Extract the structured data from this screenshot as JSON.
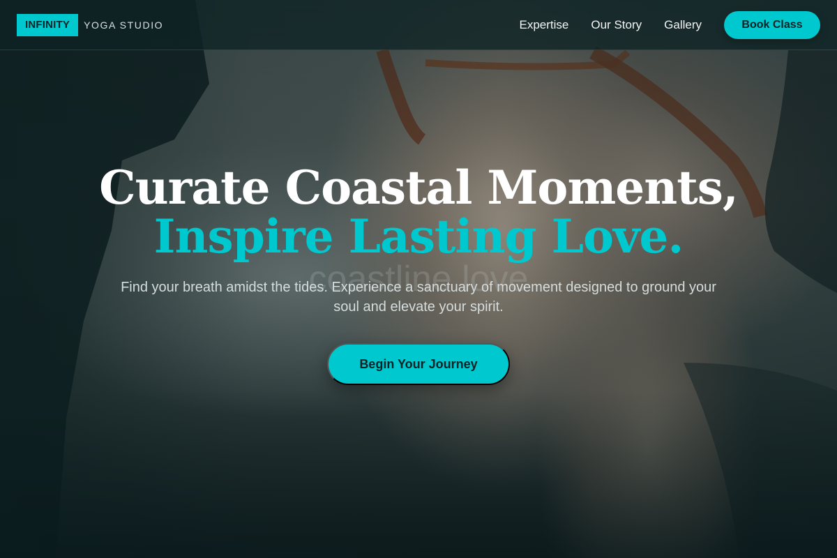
{
  "header": {
    "brand_name": "INFINITY",
    "brand_subtitle": "YOGA STUDIO",
    "nav": [
      {
        "label": "Expertise"
      },
      {
        "label": "Our Story"
      },
      {
        "label": "Gallery"
      }
    ],
    "book_button_label": "Book Class"
  },
  "hero": {
    "headline_line1": "Curate Coastal Moments,",
    "headline_line2": "Inspire Lasting Love.",
    "background_text": "coastline love",
    "subtitle": "Find your breath amidst the tides. Experience a sanctuary of movement designed to ground your soul and elevate your spirit.",
    "cta_label": "Begin Your Journey"
  },
  "colors": {
    "accent": "#00c8cf",
    "header_bg": "#0e2224",
    "text_light": "#ffffff",
    "text_muted": "#d6dddd"
  }
}
